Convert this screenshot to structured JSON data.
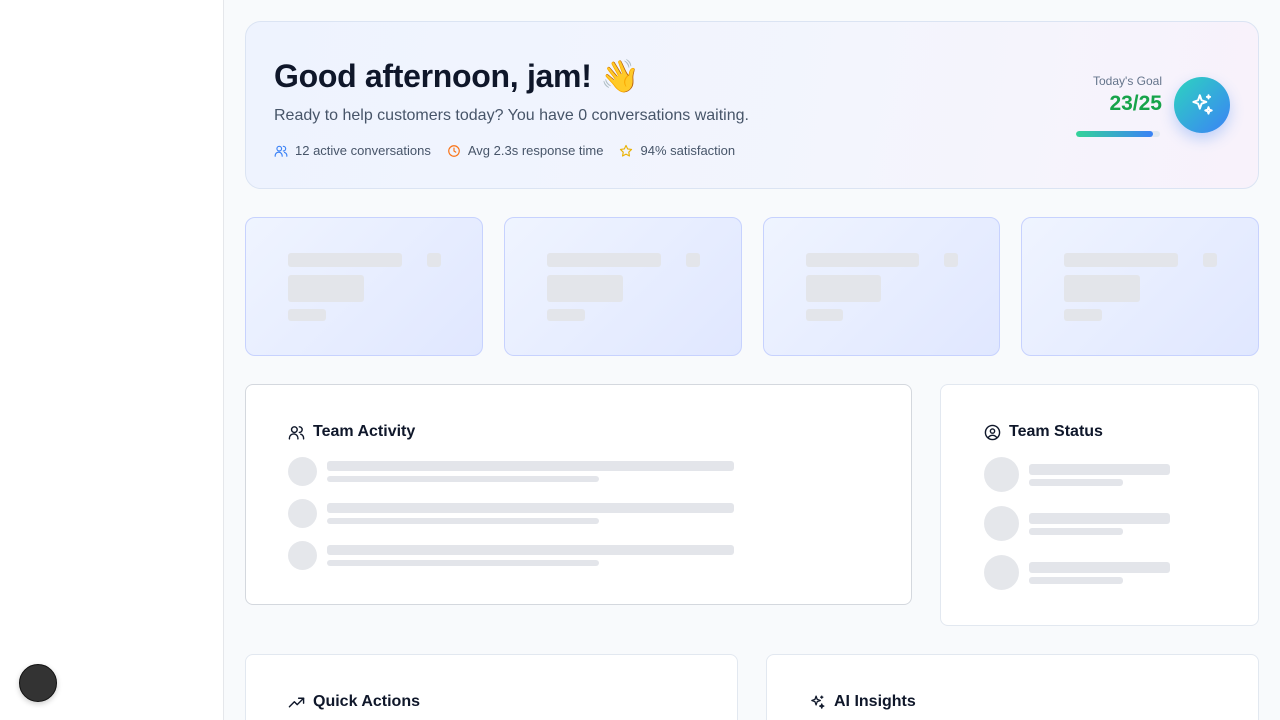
{
  "hero": {
    "greeting": "Good afternoon, jam! 👋",
    "subtitle": "Ready to help customers today? You have 0 conversations waiting.",
    "stats": [
      {
        "icon": "users-icon",
        "label": "12 active conversations",
        "color": "#3b82f6"
      },
      {
        "icon": "clock-icon",
        "label": "Avg 2.3s response time",
        "color": "#f97316"
      },
      {
        "icon": "star-icon",
        "label": "94% satisfaction",
        "color": "#eab308"
      }
    ],
    "goal": {
      "label": "Today's Goal",
      "value": "23/25",
      "progress": 0.92
    }
  },
  "panels": {
    "team_activity": {
      "title": "Team Activity",
      "icon": "users-icon"
    },
    "team_status": {
      "title": "Team Status",
      "icon": "user-circle-icon"
    },
    "quick_actions": {
      "title": "Quick Actions",
      "icon": "trending-up-icon"
    },
    "ai_insights": {
      "title": "AI Insights",
      "icon": "sparkles-icon"
    }
  },
  "colors": {
    "accent_green": "#16a34a",
    "metric_card_border": "#c7d2fe",
    "skeleton": "#e3e5ea"
  }
}
